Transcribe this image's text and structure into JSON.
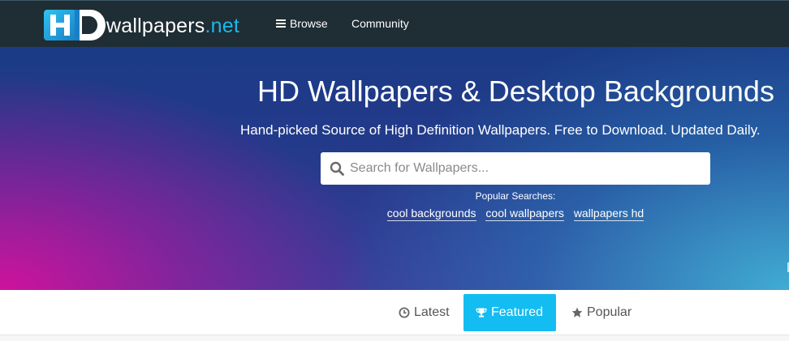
{
  "header": {
    "logo_mark_text": "HD",
    "logo_text": "wallpapers",
    "logo_tld": ".net",
    "nav": {
      "browse_label": "Browse",
      "community_label": "Community"
    }
  },
  "hero": {
    "title": "HD Wallpapers & Desktop Backgrounds",
    "subtitle": "Hand-picked Source of High Definition Wallpapers. Free to Download. Updated Daily.",
    "search": {
      "placeholder": "Search for Wallpapers...",
      "value": ""
    },
    "popular": {
      "label": "Popular Searches:",
      "links": [
        "cool backgrounds",
        "cool wallpapers",
        "wallpapers hd"
      ]
    }
  },
  "tabs": [
    {
      "label": "Latest",
      "icon": "clock-icon",
      "active": false
    },
    {
      "label": "Featured",
      "icon": "trophy-icon",
      "active": true
    },
    {
      "label": "Popular",
      "icon": "star-icon",
      "active": false
    }
  ],
  "colors": {
    "topbar_bg": "#1f2d34",
    "accent": "#14bdf1",
    "logo_tld": "#1ab8ec"
  }
}
